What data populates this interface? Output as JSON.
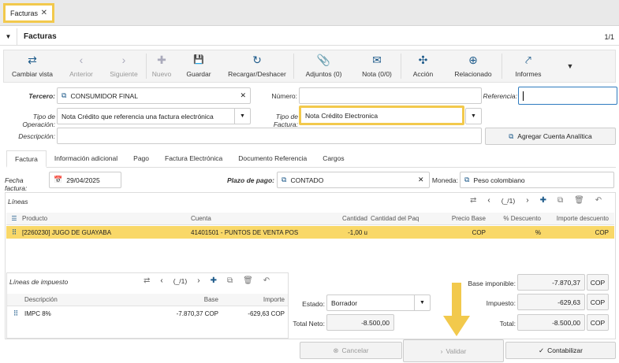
{
  "tab": {
    "label": "Facturas"
  },
  "header": {
    "title": "Facturas",
    "pager": "1/1"
  },
  "toolbar": {
    "items": [
      {
        "label": "Cambiar vista",
        "icon": "⇄"
      },
      {
        "label": "Anterior",
        "icon": "‹"
      },
      {
        "label": "Siguiente",
        "icon": "›"
      },
      {
        "label": "Nuevo",
        "icon": "✚"
      },
      {
        "label": "Guardar",
        "icon": "💾"
      },
      {
        "label": "Recargar/Deshacer",
        "icon": "↻"
      },
      {
        "label": "Adjuntos (0)",
        "icon": "📎"
      },
      {
        "label": "Nota (0/0)",
        "icon": "✉"
      },
      {
        "label": "Acción",
        "icon": "✣"
      },
      {
        "label": "Relacionado",
        "icon": "⊕"
      },
      {
        "label": "Informes",
        "icon": "⤤"
      }
    ]
  },
  "form": {
    "tercero_label": "Tercero:",
    "tercero_value": "CONSUMIDOR FINAL",
    "numero_label": "Número:",
    "numero_value": "",
    "referencia_label": "Referencia:",
    "referencia_value": "",
    "tipo_operacion_label": "Tipo de Operación:",
    "tipo_operacion_value": "Nota Crédito que referencia una factura electrónica",
    "tipo_factura_label": "Tipo de Factura:",
    "tipo_factura_value": "Nota Crédito Electronica",
    "descripcion_label": "Descripción:",
    "descripcion_value": "",
    "agregar_cuenta": "Agregar Cuenta Analítica"
  },
  "subtabs": [
    "Factura",
    "Información adicional",
    "Pago",
    "Factura Electrónica",
    "Documento Referencia",
    "Cargos"
  ],
  "factura": {
    "fecha_label": "Fecha factura:",
    "fecha_value": "29/04/2025",
    "plazo_label": "Plazo de pago:",
    "plazo_value": "CONTADO",
    "moneda_label": "Moneda:",
    "moneda_value": "Peso colombiano"
  },
  "lineas": {
    "title": "Líneas",
    "pager": "(_/1)",
    "columns": [
      "Producto",
      "Cuenta",
      "Cantidad",
      "Cantidad del Paq",
      "Precio Base",
      "% Descuento",
      "Importe descuento"
    ],
    "rows": [
      {
        "producto": "[2260230] JUGO DE GUAYABA",
        "cuenta": "41401501 - PUNTOS DE VENTA POS",
        "cantidad": "-1,00 u",
        "cant_paq": "",
        "precio": "COP",
        "descuento": "%",
        "importe_desc": "COP"
      }
    ]
  },
  "impuestos": {
    "title": "Líneas de impuesto",
    "pager": "(_/1)",
    "columns": [
      "Descripción",
      "Base",
      "Importe"
    ],
    "rows": [
      {
        "descripcion": "IMPC 8%",
        "base": "-7.870,37 COP",
        "importe": "-629,63 COP"
      }
    ]
  },
  "estado": {
    "label": "Estado:",
    "value": "Borrador"
  },
  "totales": {
    "total_neto_label": "Total Neto:",
    "total_neto": "-8.500,00",
    "base_label": "Base imponible:",
    "base": "-7.870,37",
    "impuesto_label": "Impuesto:",
    "impuesto": "-629,63",
    "total_label": "Total:",
    "total": "-8.500,00",
    "currency": "COP"
  },
  "actions": {
    "cancelar": "Cancelar",
    "validar": "Validar",
    "contabilizar": "Contabilizar"
  },
  "colors": {
    "highlight": "#f2c94c",
    "selected_row": "#f9d868",
    "accent": "#1d5a8a"
  }
}
